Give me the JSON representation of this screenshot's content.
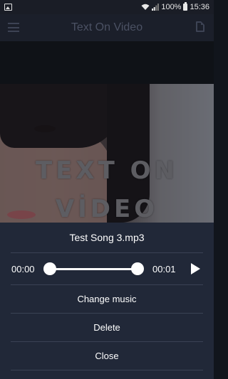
{
  "status_bar": {
    "battery_percent": "100%",
    "time": "15:36",
    "icons": [
      "image-icon",
      "wifi-icon",
      "signal-icon",
      "battery-icon"
    ]
  },
  "app_bar": {
    "title": "Text On Video",
    "left_icon": "menu-icon",
    "right_icon": "file-icon"
  },
  "video": {
    "overlay_line_1": "TEXT ON",
    "overlay_line_2": "VİDEO"
  },
  "music_sheet": {
    "song_name": "Test Song 3.mp3",
    "time_start": "00:00",
    "time_end": "00:01",
    "play_icon": "play-icon",
    "actions": {
      "change": "Change music",
      "delete": "Delete",
      "close": "Close"
    }
  },
  "colors": {
    "sheet_bg": "#212838",
    "app_bar_bg": "#1b1f2a",
    "text": "#ffffff"
  }
}
